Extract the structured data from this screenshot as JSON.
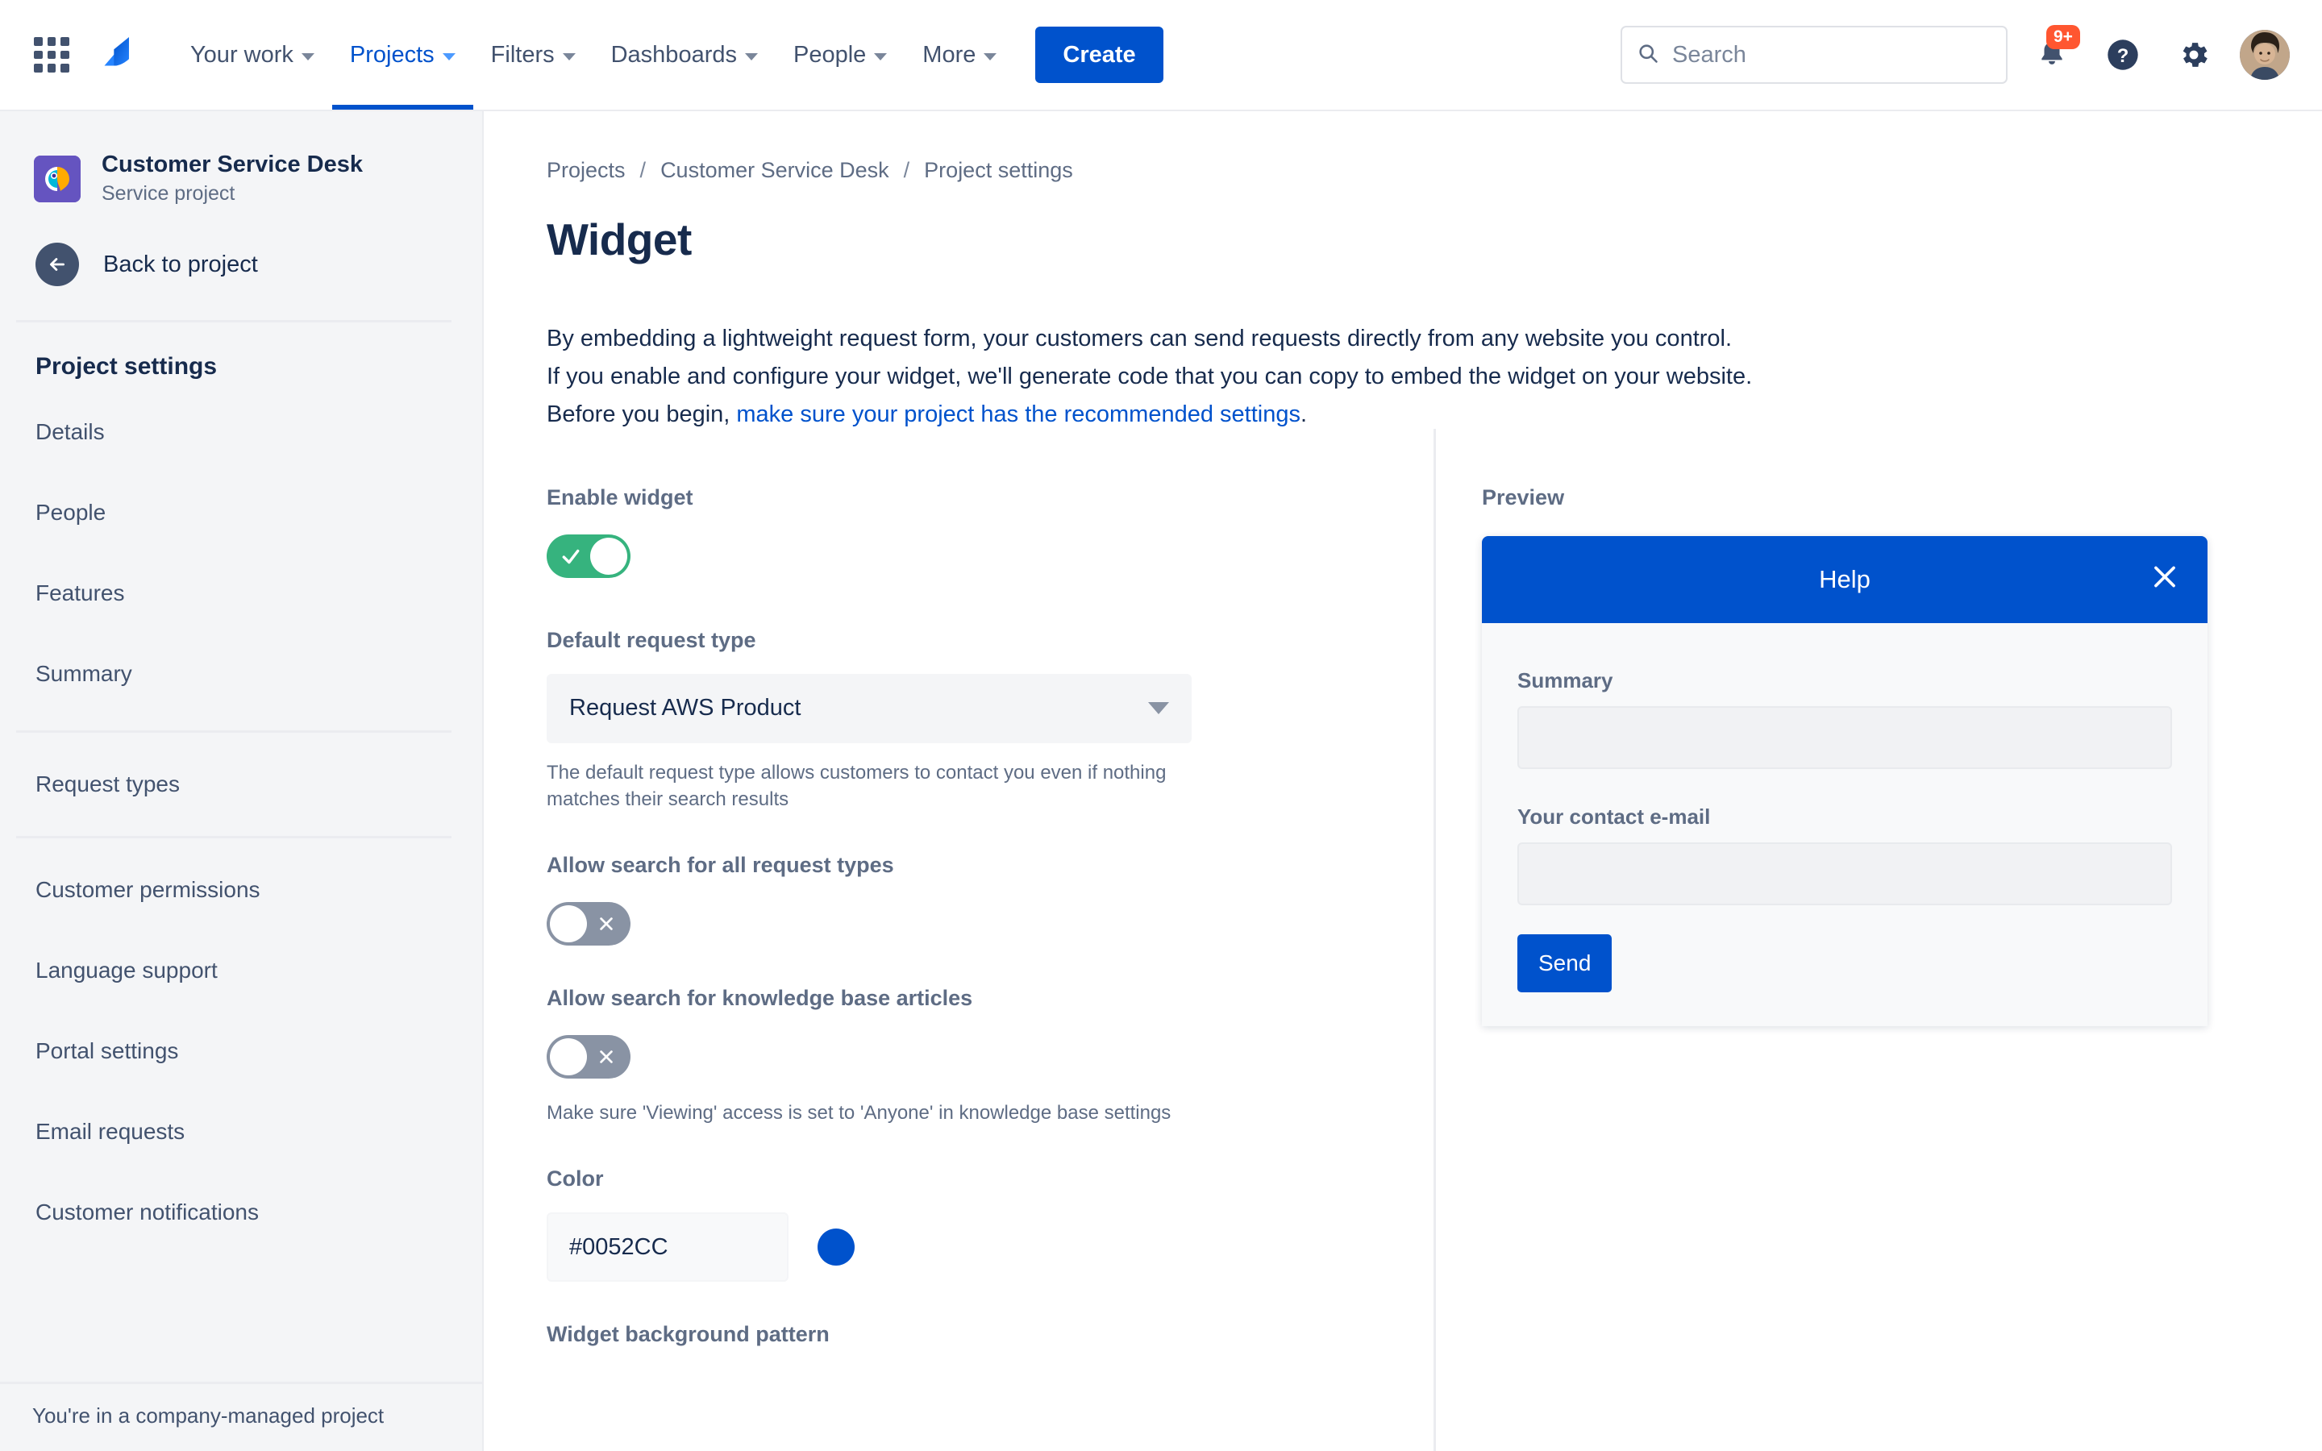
{
  "topnav": {
    "app_switcher_icon": "grid-apps-icon",
    "logo_icon": "jira-logo-icon",
    "items": [
      {
        "label": "Your work",
        "active": false
      },
      {
        "label": "Projects",
        "active": true
      },
      {
        "label": "Filters",
        "active": false
      },
      {
        "label": "Dashboards",
        "active": false
      },
      {
        "label": "People",
        "active": false
      },
      {
        "label": "More",
        "active": false
      }
    ],
    "create_label": "Create",
    "search": {
      "placeholder": "Search",
      "value": "",
      "icon": "search-icon"
    },
    "notifications": {
      "icon": "bell-icon",
      "badge": "9+"
    },
    "help": {
      "icon": "help-circle-icon"
    },
    "settings": {
      "icon": "gear-icon"
    },
    "avatar": {
      "icon": "user-avatar"
    },
    "accent_color": "#0052CC",
    "badge_color": "#FF5630"
  },
  "sidebar": {
    "project": {
      "name": "Customer Service Desk",
      "type": "Service project",
      "icon": "service-project-avatar",
      "icon_bg": "#6554C0"
    },
    "back_label": "Back to project",
    "back_icon": "arrow-left-icon",
    "section_title": "Project settings",
    "group_one": [
      {
        "label": "Details"
      },
      {
        "label": "People"
      },
      {
        "label": "Features"
      },
      {
        "label": "Summary"
      }
    ],
    "group_two": [
      {
        "label": "Request types"
      }
    ],
    "group_three": [
      {
        "label": "Customer permissions"
      },
      {
        "label": "Language support"
      },
      {
        "label": "Portal settings"
      },
      {
        "label": "Email requests"
      },
      {
        "label": "Customer notifications"
      }
    ],
    "footer": "You're in a company-managed project"
  },
  "breadcrumb": [
    {
      "label": "Projects"
    },
    {
      "label": "Customer Service Desk"
    },
    {
      "label": "Project settings"
    }
  ],
  "breadcrumb_separator": "/",
  "page": {
    "title": "Widget",
    "intro_line1": "By embedding a lightweight request form, your customers can send requests directly from any website you control.",
    "intro_line2": "If you enable and configure your widget, we'll generate code that you can copy to embed the widget on your website.",
    "intro_line3_prefix": "Before you begin, ",
    "intro_link": "make sure your project has the recommended settings",
    "intro_line3_suffix": "."
  },
  "form": {
    "enable_widget": {
      "label": "Enable widget",
      "state": "on",
      "glyph": "check-icon",
      "on_color": "#36B37E"
    },
    "default_request_type": {
      "label": "Default request type",
      "value": "Request AWS Product",
      "help": "The default request type allows customers to contact you even if nothing matches their search results"
    },
    "allow_search_all_request_types": {
      "label": "Allow search for all request types",
      "state": "off",
      "glyph": "x-icon",
      "off_color": "#8993A4"
    },
    "allow_search_kb_articles": {
      "label": "Allow search for knowledge base articles",
      "state": "off",
      "glyph": "x-icon",
      "off_color": "#8993A4",
      "help": "Make sure 'Viewing' access is set to 'Anyone' in knowledge base settings"
    },
    "color": {
      "label": "Color",
      "value": "#0052CC",
      "swatch": "#0052CC"
    },
    "background_pattern": {
      "label": "Widget background pattern"
    }
  },
  "preview": {
    "label": "Preview",
    "widget": {
      "title": "Help",
      "close_icon": "close-x-icon",
      "header_color": "#0052CC",
      "fields": [
        {
          "label": "Summary",
          "value": ""
        },
        {
          "label": "Your contact e-mail",
          "value": ""
        }
      ],
      "submit_label": "Send"
    }
  }
}
